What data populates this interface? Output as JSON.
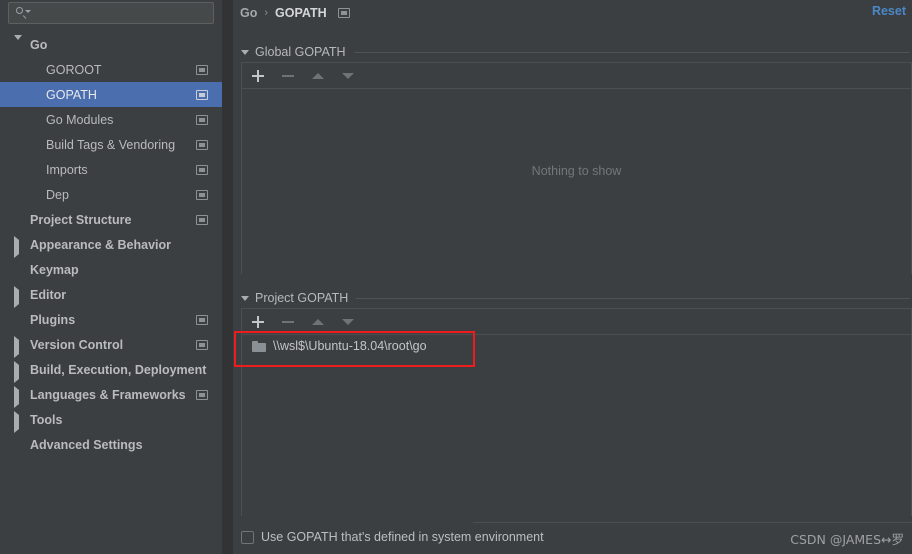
{
  "window": {
    "accent_blue": "#4b6eaf",
    "link_blue": "#4a88c7",
    "annotation_red": "#ee1c1c",
    "background": "#3c3f41"
  },
  "search": {
    "placeholder": "",
    "value": "",
    "icon": "search-icon"
  },
  "sidebar": {
    "items": [
      {
        "label": "Go",
        "depth": 0,
        "arrow": "down",
        "bold": true,
        "has_module_icon": false,
        "selected": false
      },
      {
        "label": "GOROOT",
        "depth": 1,
        "arrow": "none",
        "bold": false,
        "has_module_icon": true,
        "selected": false
      },
      {
        "label": "GOPATH",
        "depth": 1,
        "arrow": "none",
        "bold": false,
        "has_module_icon": true,
        "selected": true
      },
      {
        "label": "Go Modules",
        "depth": 1,
        "arrow": "none",
        "bold": false,
        "has_module_icon": true,
        "selected": false
      },
      {
        "label": "Build Tags & Vendoring",
        "depth": 1,
        "arrow": "none",
        "bold": false,
        "has_module_icon": true,
        "selected": false
      },
      {
        "label": "Imports",
        "depth": 1,
        "arrow": "none",
        "bold": false,
        "has_module_icon": true,
        "selected": false
      },
      {
        "label": "Dep",
        "depth": 1,
        "arrow": "none",
        "bold": false,
        "has_module_icon": true,
        "selected": false
      },
      {
        "label": "Project Structure",
        "depth": 0,
        "arrow": "none",
        "bold": true,
        "has_module_icon": true,
        "selected": false
      },
      {
        "label": "Appearance & Behavior",
        "depth": 0,
        "arrow": "right",
        "bold": true,
        "has_module_icon": false,
        "selected": false
      },
      {
        "label": "Keymap",
        "depth": 0,
        "arrow": "none",
        "bold": true,
        "has_module_icon": false,
        "selected": false
      },
      {
        "label": "Editor",
        "depth": 0,
        "arrow": "right",
        "bold": true,
        "has_module_icon": false,
        "selected": false
      },
      {
        "label": "Plugins",
        "depth": 0,
        "arrow": "none",
        "bold": true,
        "has_module_icon": true,
        "selected": false
      },
      {
        "label": "Version Control",
        "depth": 0,
        "arrow": "right",
        "bold": true,
        "has_module_icon": true,
        "selected": false
      },
      {
        "label": "Build, Execution, Deployment",
        "depth": 0,
        "arrow": "right",
        "bold": true,
        "has_module_icon": false,
        "selected": false
      },
      {
        "label": "Languages & Frameworks",
        "depth": 0,
        "arrow": "right",
        "bold": true,
        "has_module_icon": true,
        "selected": false
      },
      {
        "label": "Tools",
        "depth": 0,
        "arrow": "right",
        "bold": true,
        "has_module_icon": false,
        "selected": false
      },
      {
        "label": "Advanced Settings",
        "depth": 0,
        "arrow": "none",
        "bold": true,
        "has_module_icon": false,
        "selected": false
      }
    ]
  },
  "header": {
    "breadcrumb_root": "Go",
    "breadcrumb_separator": "›",
    "breadcrumb_current": "GOPATH",
    "reset_label": "Reset"
  },
  "global_gopath": {
    "title": "Global GOPATH",
    "toolbar": {
      "add_label": "+",
      "remove_label": "−",
      "move_up_label": "▲",
      "move_down_label": "▼"
    },
    "empty_message": "Nothing to show",
    "entries": []
  },
  "project_gopath": {
    "title": "Project GOPATH",
    "toolbar": {
      "add_label": "+",
      "remove_label": "−",
      "move_up_label": "▲",
      "move_down_label": "▼"
    },
    "entries": [
      {
        "path": "\\\\wsl$\\Ubuntu-18.04\\root\\go",
        "icon": "folder-icon"
      }
    ]
  },
  "footer": {
    "checkbox_label": "Use GOPATH that's defined in system environment",
    "checkbox_checked": false,
    "watermark": "CSDN @JAMES↔罗"
  }
}
